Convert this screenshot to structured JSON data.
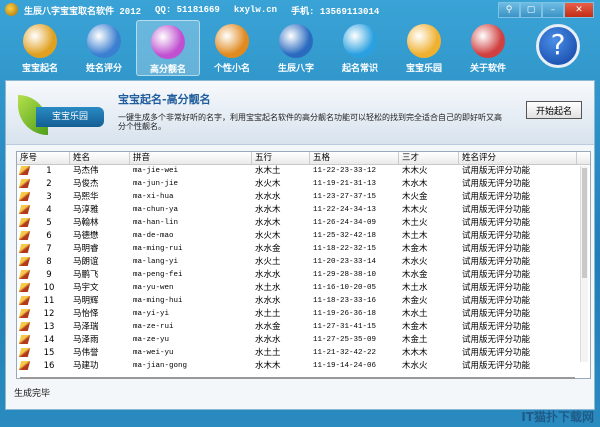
{
  "title": {
    "app": "生辰八字宝宝取名软件 2012",
    "qq": "QQ: 51181669",
    "site": "kxylw.cn",
    "phone": "手机: 13569113014",
    "buttons": [
      "⚲",
      "▢",
      "–",
      "✕"
    ]
  },
  "toolbar": [
    {
      "label": "宝宝起名",
      "icon": "yin-yang-icon",
      "color": "#e0a020"
    },
    {
      "label": "姓名评分",
      "icon": "globe-icon",
      "color": "#3b7fd0"
    },
    {
      "label": "高分靓名",
      "icon": "hexagon-flower-icon",
      "color": "#c050d0",
      "active": true
    },
    {
      "label": "个性小名",
      "icon": "windows-squares-icon",
      "color": "#e08a20"
    },
    {
      "label": "生辰八字",
      "icon": "wings-icon",
      "color": "#2a6bc0"
    },
    {
      "label": "起名常识",
      "icon": "ie-drop-icon",
      "color": "#2aa0e0"
    },
    {
      "label": "宝宝乐园",
      "icon": "cartoon-chick-icon",
      "color": "#f0b030"
    },
    {
      "label": "关于软件",
      "icon": "butterfly-icon",
      "color": "#d04040"
    }
  ],
  "help": "?",
  "banner": {
    "logo_text": "宝宝乐园",
    "title": "宝宝起名-高分靓名",
    "desc": "一键生成多个非常好听的名字，利用宝宝起名软件的高分靓名功能可以轻松的找到完全适合自己的即好听又高分个性靓名。",
    "start_button": "开始起名"
  },
  "table": {
    "headers": [
      "序号",
      "姓名",
      "拼音",
      "五行",
      "五格",
      "三才",
      "姓名评分"
    ],
    "rows": [
      [
        "1",
        "马杰伟",
        "ma-jie-wei",
        "水木土",
        "11-22-23-33-12",
        "木木火",
        "试用版无评分功能"
      ],
      [
        "2",
        "马俊杰",
        "ma-jun-jie",
        "水火木",
        "11-19-21-31-13",
        "木水木",
        "试用版无评分功能"
      ],
      [
        "3",
        "马熙华",
        "ma-xi-hua",
        "水水水",
        "11-23-27-37-15",
        "木火金",
        "试用版无评分功能"
      ],
      [
        "4",
        "马淳雅",
        "ma-chun-ya",
        "水水木",
        "11-22-24-34-13",
        "木木火",
        "试用版无评分功能"
      ],
      [
        "5",
        "马翰林",
        "ma-han-lin",
        "水水木",
        "11-26-24-34-09",
        "木土火",
        "试用版无评分功能"
      ],
      [
        "6",
        "马德懋",
        "ma-de-mao",
        "水火木",
        "11-25-32-42-18",
        "木土木",
        "试用版无评分功能"
      ],
      [
        "7",
        "马明睿",
        "ma-ming-rui",
        "水水金",
        "11-18-22-32-15",
        "木金木",
        "试用版无评分功能"
      ],
      [
        "8",
        "马朗谊",
        "ma-lang-yi",
        "水火土",
        "11-20-23-33-14",
        "木水火",
        "试用版无评分功能"
      ],
      [
        "9",
        "马鹏飞",
        "ma-peng-fei",
        "水水水",
        "11-29-28-38-10",
        "木水金",
        "试用版无评分功能"
      ],
      [
        "10",
        "马宇文",
        "ma-yu-wen",
        "水土水",
        "11-16-10-20-05",
        "木土水",
        "试用版无评分功能"
      ],
      [
        "11",
        "马明辉",
        "ma-ming-hui",
        "水水水",
        "11-18-23-33-16",
        "木金火",
        "试用版无评分功能"
      ],
      [
        "12",
        "马怡怿",
        "ma-yi-yi",
        "水土土",
        "11-19-26-36-18",
        "木水土",
        "试用版无评分功能"
      ],
      [
        "13",
        "马泽瑞",
        "ma-ze-rui",
        "水水金",
        "11-27-31-41-15",
        "木金木",
        "试用版无评分功能"
      ],
      [
        "14",
        "马泽雨",
        "ma-ze-yu",
        "水水水",
        "11-27-25-35-09",
        "木金土",
        "试用版无评分功能"
      ],
      [
        "15",
        "马伟誉",
        "ma-wei-yu",
        "水土土",
        "11-21-32-42-22",
        "木木木",
        "试用版无评分功能"
      ],
      [
        "16",
        "马建功",
        "ma-jian-gong",
        "水木木",
        "11-19-14-24-06",
        "木水火",
        "试用版无评分功能"
      ]
    ]
  },
  "status": "生成完毕",
  "watermark": "IT猫扑下载网"
}
